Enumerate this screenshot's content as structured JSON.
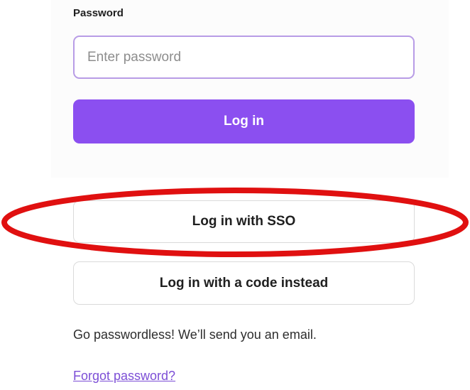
{
  "password_label": "Password",
  "password_input": {
    "placeholder": "Enter password",
    "value": ""
  },
  "buttons": {
    "login": "Log in",
    "sso": "Log in with SSO",
    "code": "Log in with a code instead"
  },
  "hint_text": "Go passwordless! We’ll send you an email.",
  "forgot_link": "Forgot password?",
  "colors": {
    "primary": "#8b4ff0",
    "input_border": "#b89ce6",
    "link": "#7c4ed6",
    "highlight": "#e01010"
  }
}
